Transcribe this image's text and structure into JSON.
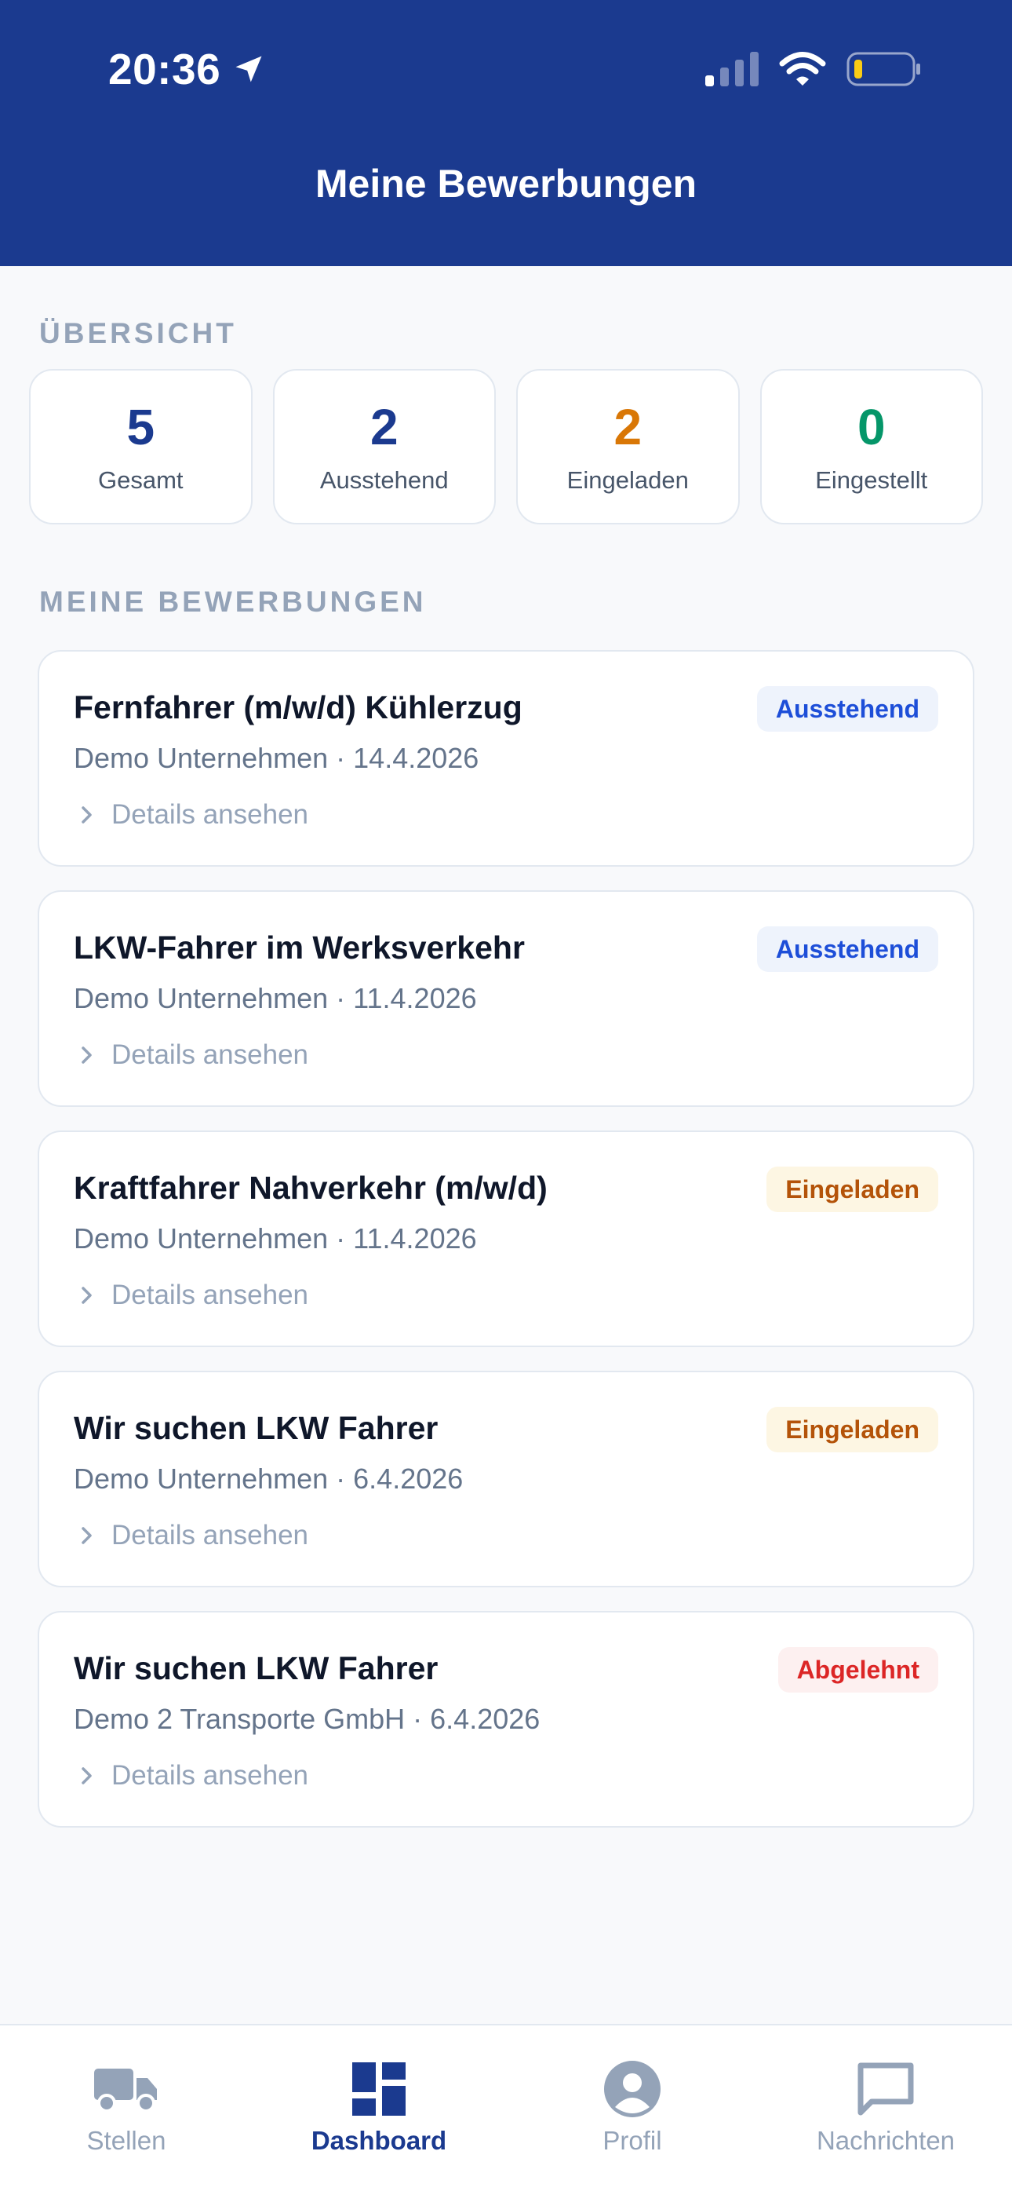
{
  "status_bar": {
    "time": "20:36"
  },
  "header": {
    "title": "Meine Bewerbungen"
  },
  "overview": {
    "label": "ÜBERSICHT",
    "stats": [
      {
        "value": "5",
        "label": "Gesamt",
        "color": "#1b3a8f"
      },
      {
        "value": "2",
        "label": "Ausstehend",
        "color": "#1b3a8f"
      },
      {
        "value": "2",
        "label": "Eingeladen",
        "color": "#d97706"
      },
      {
        "value": "0",
        "label": "Eingestellt",
        "color": "#059669"
      }
    ]
  },
  "applications": {
    "label": "MEINE BEWERBUNGEN",
    "details_label": "Details ansehen",
    "items": [
      {
        "title": "Fernfahrer (m/w/d) Kühlerzug",
        "subtitle": "Demo Unternehmen · 14.4.2026",
        "status": "Ausstehend"
      },
      {
        "title": "LKW-Fahrer im Werksverkehr",
        "subtitle": "Demo Unternehmen · 11.4.2026",
        "status": "Ausstehend"
      },
      {
        "title": "Kraftfahrer Nahverkehr (m/w/d)",
        "subtitle": "Demo Unternehmen · 11.4.2026",
        "status": "Eingeladen"
      },
      {
        "title": "Wir suchen LKW Fahrer",
        "subtitle": "Demo Unternehmen · 6.4.2026",
        "status": "Eingeladen"
      },
      {
        "title": "Wir suchen LKW Fahrer",
        "subtitle": "Demo 2 Transporte GmbH · 6.4.2026",
        "status": "Abgelehnt"
      }
    ]
  },
  "tabbar": {
    "tabs": [
      {
        "label": "Stellen",
        "icon": "truck-icon"
      },
      {
        "label": "Dashboard",
        "icon": "dashboard-icon",
        "active": true
      },
      {
        "label": "Profil",
        "icon": "profile-icon"
      },
      {
        "label": "Nachrichten",
        "icon": "message-icon"
      }
    ]
  },
  "colors": {
    "primary": "#1b3a8f",
    "background": "#f8f9fb"
  }
}
